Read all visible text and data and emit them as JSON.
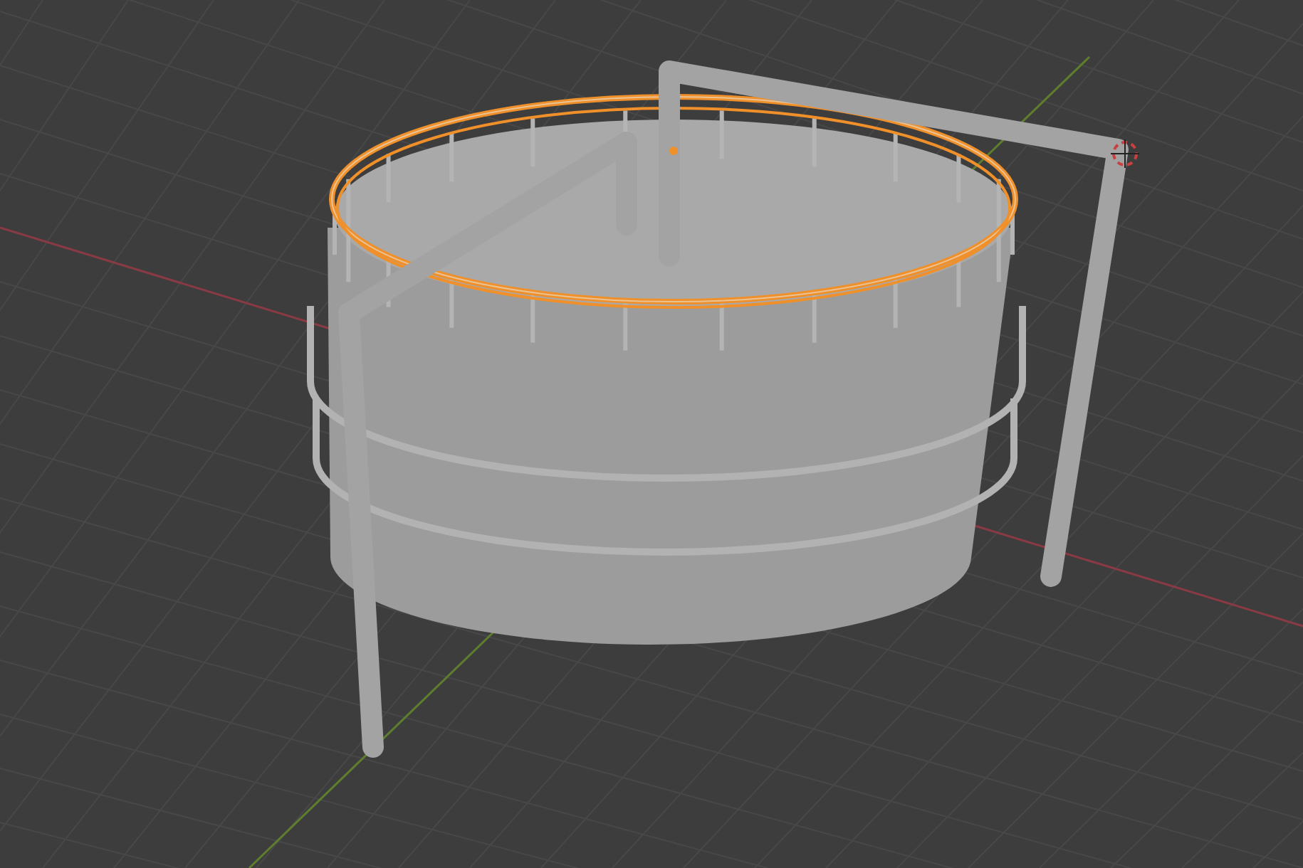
{
  "viewport": {
    "objects": [
      {
        "kind": "tank",
        "selected": false
      },
      {
        "kind": "ring",
        "selected": false
      },
      {
        "kind": "railing",
        "selected": true
      },
      {
        "kind": "pipe",
        "selected": false
      },
      {
        "kind": "pipe",
        "selected": false
      }
    ]
  }
}
